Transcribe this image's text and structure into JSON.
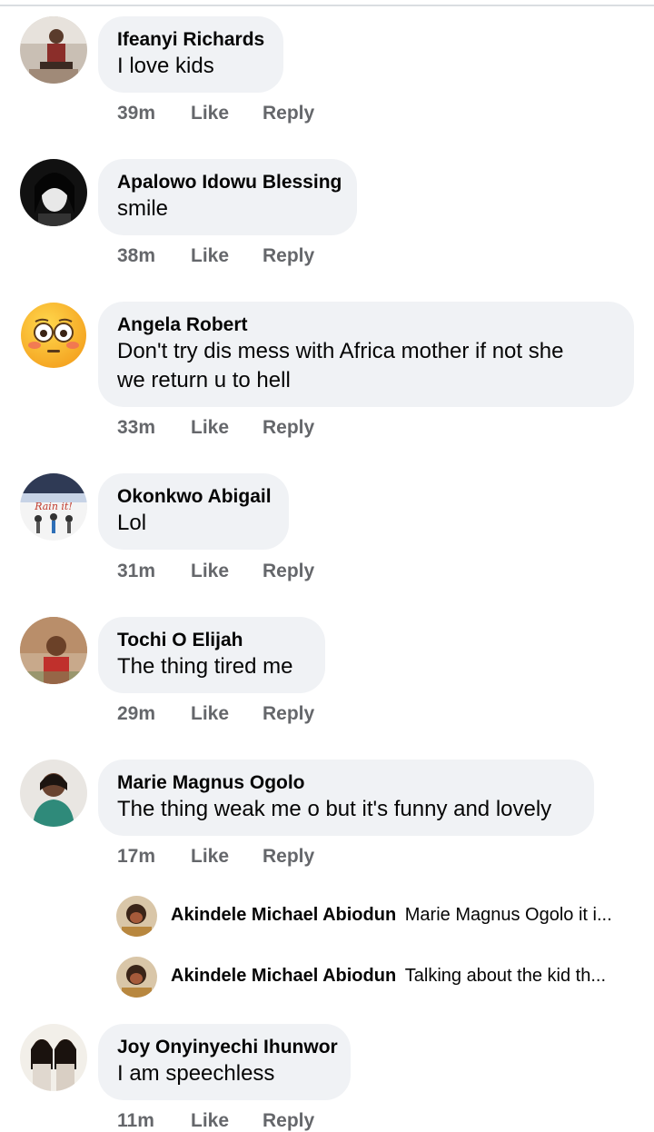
{
  "comments": [
    {
      "name": "Ifeanyi Richards",
      "text": "I love kids",
      "time": "39m",
      "like": "Like",
      "reply": "Reply",
      "avatar": "person-photo-avatar"
    },
    {
      "name": "Apalowo Idowu Blessing",
      "text": "smile",
      "time": "38m",
      "like": "Like",
      "reply": "Reply",
      "avatar": "woman-bw-photo-avatar"
    },
    {
      "name": "Angela Robert",
      "text": " Don't try dis mess with Africa mother if not she",
      "text2": "we return u to hell",
      "time": "33m",
      "like": "Like",
      "reply": "Reply",
      "avatar": "flushed-emoji-avatar"
    },
    {
      "name": "Okonkwo Abigail",
      "text": "Lol",
      "time": "31m",
      "like": "Like",
      "reply": "Reply",
      "avatar": "cartoon-graphic-avatar"
    },
    {
      "name": "Tochi O Elijah",
      "text": "The thing tired me",
      "time": "29m",
      "like": "Like",
      "reply": "Reply",
      "avatar": "man-photo-avatar"
    },
    {
      "name": "Marie Magnus Ogolo",
      "text": "The thing weak me o but it's funny and lovely",
      "time": "17m",
      "like": "Like",
      "reply": "Reply",
      "avatar": "woman-photo-avatar"
    },
    {
      "name": "Joy Onyinyechi Ihunwor",
      "text": "I am speechless",
      "time": "11m",
      "like": "Like",
      "reply": "Reply",
      "avatar": "two-women-photo-avatar"
    }
  ],
  "replies": [
    {
      "name": "Akindele Michael Abiodun",
      "text": "Marie Magnus Ogolo it i..."
    },
    {
      "name": "Akindele Michael Abiodun",
      "text": "Talking about the kid th..."
    }
  ]
}
